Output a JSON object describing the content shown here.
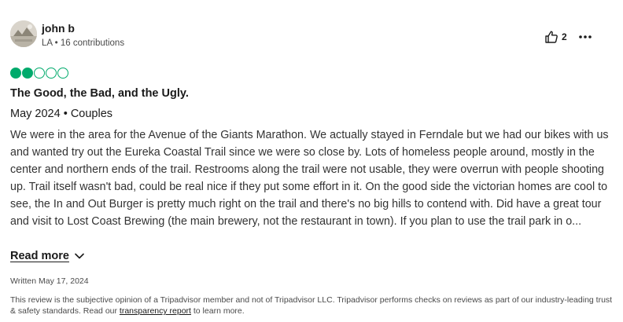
{
  "reviewer": {
    "name": "john b",
    "location": "LA",
    "separator": "•",
    "contributions": "16 contributions"
  },
  "helpful": {
    "count": "2",
    "icon": "thumbs-up-icon"
  },
  "more_icon": "more-horizontal-icon",
  "rating": {
    "value": 2,
    "max": 5,
    "color": "#00aa6c"
  },
  "review": {
    "title": "The Good, the Bad, and the Ugly.",
    "trip_date": "May 2024",
    "trip_type": "Couples",
    "body": "We were in the area for the Avenue of the Giants Marathon. We actually stayed in Ferndale but we had our bikes with us and wanted try out the Eureka Coastal Trail since we were so close by. Lots of homeless people around, mostly in the center and northern ends of the trail. Restrooms along the trail were not usable, they were overrun with people shooting up. Trail itself wasn't bad, could be real nice if they put some effort in it. On the good side the victorian homes are cool to see, the In and Out Burger is pretty much right on the trail and there's no big hills to contend with. Did have a great tour and visit to Lost Coast Brewing (the main brewery, not the restaurant in town). If you plan to use the trail park in o...",
    "read_more_label": "Read more",
    "written_date": "Written May 17, 2024"
  },
  "disclaimer": {
    "before": "This review is the subjective opinion of a Tripadvisor member and not of Tripadvisor LLC. Tripadvisor performs checks on reviews as part of our industry-leading trust & safety standards. Read our ",
    "link": "transparency report",
    "after": " to learn more."
  }
}
